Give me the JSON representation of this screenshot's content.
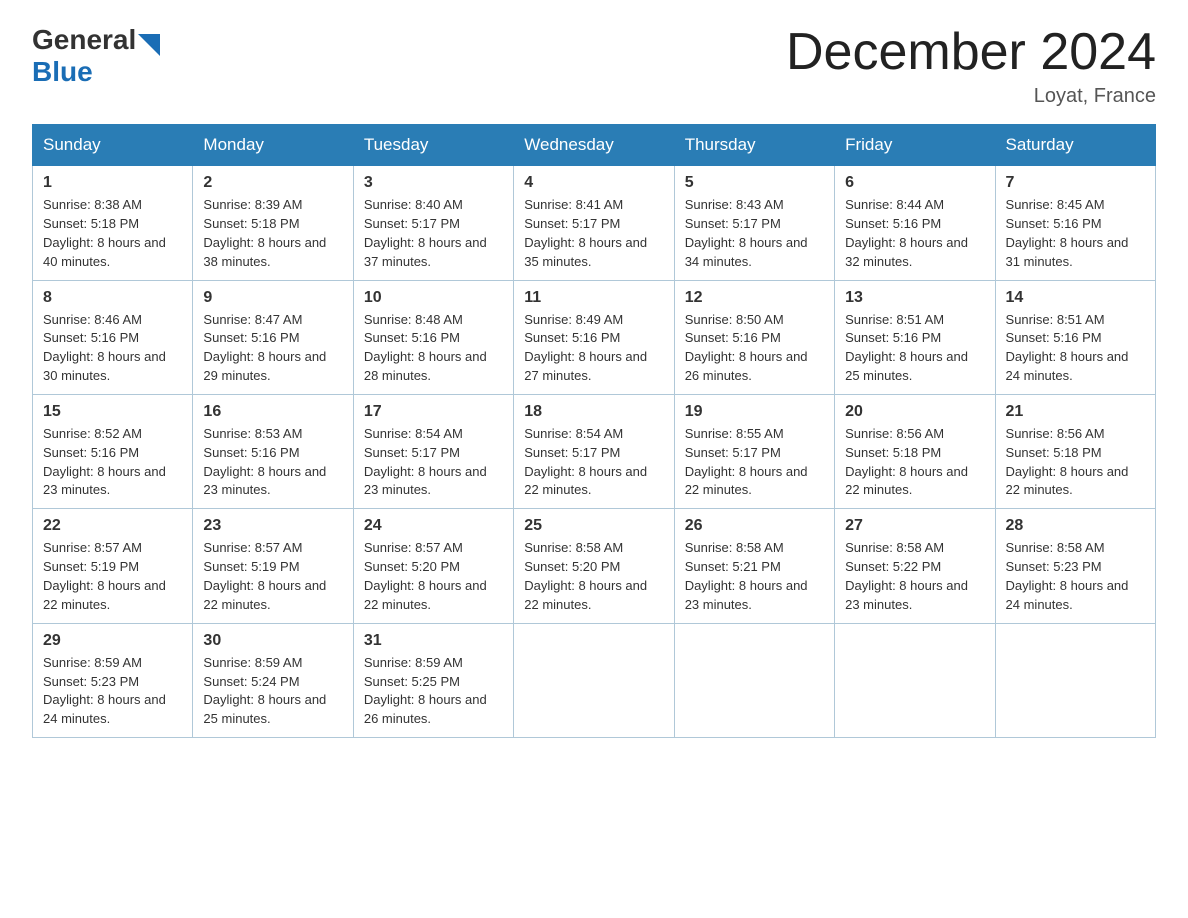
{
  "logo": {
    "general": "General",
    "blue": "Blue",
    "arrow_color": "#1a6db5"
  },
  "title": {
    "month_year": "December 2024",
    "location": "Loyat, France"
  },
  "weekdays": [
    "Sunday",
    "Monday",
    "Tuesday",
    "Wednesday",
    "Thursday",
    "Friday",
    "Saturday"
  ],
  "weeks": [
    [
      {
        "day": "1",
        "sunrise": "8:38 AM",
        "sunset": "5:18 PM",
        "daylight": "8 hours and 40 minutes."
      },
      {
        "day": "2",
        "sunrise": "8:39 AM",
        "sunset": "5:18 PM",
        "daylight": "8 hours and 38 minutes."
      },
      {
        "day": "3",
        "sunrise": "8:40 AM",
        "sunset": "5:17 PM",
        "daylight": "8 hours and 37 minutes."
      },
      {
        "day": "4",
        "sunrise": "8:41 AM",
        "sunset": "5:17 PM",
        "daylight": "8 hours and 35 minutes."
      },
      {
        "day": "5",
        "sunrise": "8:43 AM",
        "sunset": "5:17 PM",
        "daylight": "8 hours and 34 minutes."
      },
      {
        "day": "6",
        "sunrise": "8:44 AM",
        "sunset": "5:16 PM",
        "daylight": "8 hours and 32 minutes."
      },
      {
        "day": "7",
        "sunrise": "8:45 AM",
        "sunset": "5:16 PM",
        "daylight": "8 hours and 31 minutes."
      }
    ],
    [
      {
        "day": "8",
        "sunrise": "8:46 AM",
        "sunset": "5:16 PM",
        "daylight": "8 hours and 30 minutes."
      },
      {
        "day": "9",
        "sunrise": "8:47 AM",
        "sunset": "5:16 PM",
        "daylight": "8 hours and 29 minutes."
      },
      {
        "day": "10",
        "sunrise": "8:48 AM",
        "sunset": "5:16 PM",
        "daylight": "8 hours and 28 minutes."
      },
      {
        "day": "11",
        "sunrise": "8:49 AM",
        "sunset": "5:16 PM",
        "daylight": "8 hours and 27 minutes."
      },
      {
        "day": "12",
        "sunrise": "8:50 AM",
        "sunset": "5:16 PM",
        "daylight": "8 hours and 26 minutes."
      },
      {
        "day": "13",
        "sunrise": "8:51 AM",
        "sunset": "5:16 PM",
        "daylight": "8 hours and 25 minutes."
      },
      {
        "day": "14",
        "sunrise": "8:51 AM",
        "sunset": "5:16 PM",
        "daylight": "8 hours and 24 minutes."
      }
    ],
    [
      {
        "day": "15",
        "sunrise": "8:52 AM",
        "sunset": "5:16 PM",
        "daylight": "8 hours and 23 minutes."
      },
      {
        "day": "16",
        "sunrise": "8:53 AM",
        "sunset": "5:16 PM",
        "daylight": "8 hours and 23 minutes."
      },
      {
        "day": "17",
        "sunrise": "8:54 AM",
        "sunset": "5:17 PM",
        "daylight": "8 hours and 23 minutes."
      },
      {
        "day": "18",
        "sunrise": "8:54 AM",
        "sunset": "5:17 PM",
        "daylight": "8 hours and 22 minutes."
      },
      {
        "day": "19",
        "sunrise": "8:55 AM",
        "sunset": "5:17 PM",
        "daylight": "8 hours and 22 minutes."
      },
      {
        "day": "20",
        "sunrise": "8:56 AM",
        "sunset": "5:18 PM",
        "daylight": "8 hours and 22 minutes."
      },
      {
        "day": "21",
        "sunrise": "8:56 AM",
        "sunset": "5:18 PM",
        "daylight": "8 hours and 22 minutes."
      }
    ],
    [
      {
        "day": "22",
        "sunrise": "8:57 AM",
        "sunset": "5:19 PM",
        "daylight": "8 hours and 22 minutes."
      },
      {
        "day": "23",
        "sunrise": "8:57 AM",
        "sunset": "5:19 PM",
        "daylight": "8 hours and 22 minutes."
      },
      {
        "day": "24",
        "sunrise": "8:57 AM",
        "sunset": "5:20 PM",
        "daylight": "8 hours and 22 minutes."
      },
      {
        "day": "25",
        "sunrise": "8:58 AM",
        "sunset": "5:20 PM",
        "daylight": "8 hours and 22 minutes."
      },
      {
        "day": "26",
        "sunrise": "8:58 AM",
        "sunset": "5:21 PM",
        "daylight": "8 hours and 23 minutes."
      },
      {
        "day": "27",
        "sunrise": "8:58 AM",
        "sunset": "5:22 PM",
        "daylight": "8 hours and 23 minutes."
      },
      {
        "day": "28",
        "sunrise": "8:58 AM",
        "sunset": "5:23 PM",
        "daylight": "8 hours and 24 minutes."
      }
    ],
    [
      {
        "day": "29",
        "sunrise": "8:59 AM",
        "sunset": "5:23 PM",
        "daylight": "8 hours and 24 minutes."
      },
      {
        "day": "30",
        "sunrise": "8:59 AM",
        "sunset": "5:24 PM",
        "daylight": "8 hours and 25 minutes."
      },
      {
        "day": "31",
        "sunrise": "8:59 AM",
        "sunset": "5:25 PM",
        "daylight": "8 hours and 26 minutes."
      },
      null,
      null,
      null,
      null
    ]
  ],
  "labels": {
    "sunrise": "Sunrise:",
    "sunset": "Sunset:",
    "daylight": "Daylight:"
  }
}
